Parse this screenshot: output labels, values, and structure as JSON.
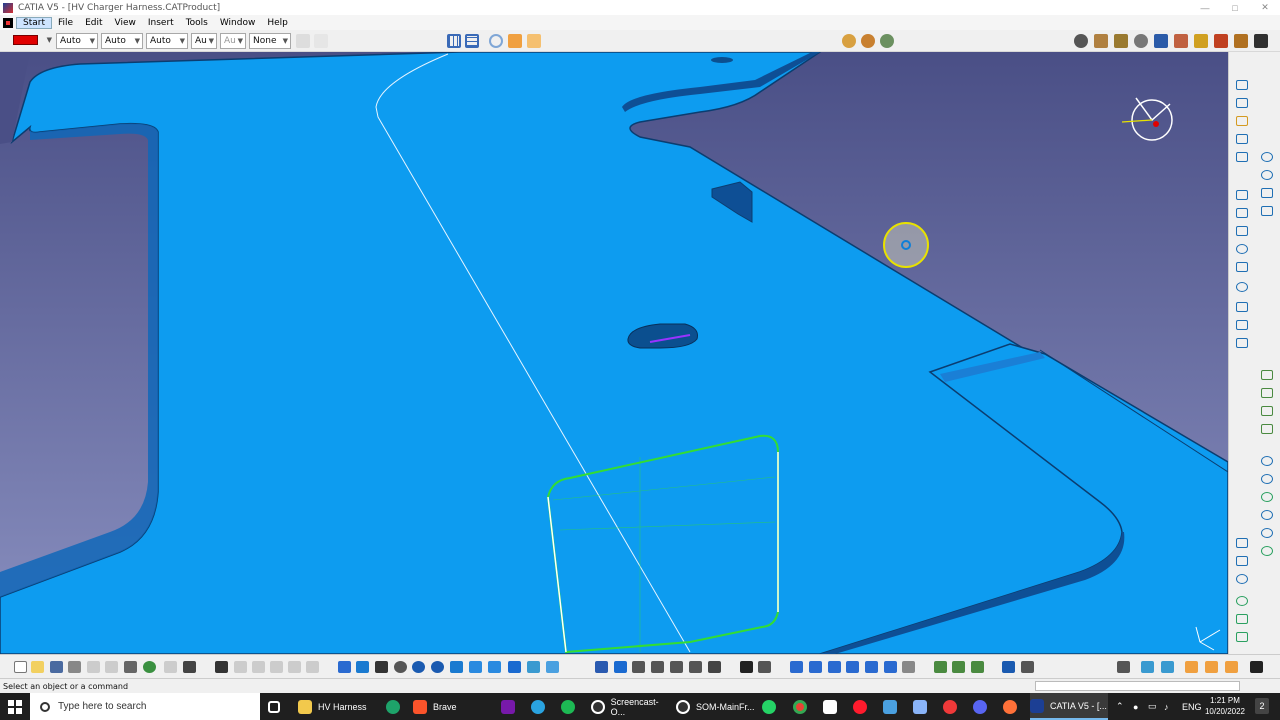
{
  "window": {
    "title": "CATIA V5 - [HV Charger Harness.CATProduct]",
    "controls": [
      "minimize-icon",
      "maximize-icon",
      "close-icon"
    ]
  },
  "menubar": {
    "items": [
      "Start",
      "File",
      "Edit",
      "View",
      "Insert",
      "Tools",
      "Window",
      "Help"
    ]
  },
  "toolbar": {
    "color_swatch": "#e00000",
    "combos": [
      {
        "value": "Auto"
      },
      {
        "value": "Auto"
      },
      {
        "value": "Auto"
      },
      {
        "value": "Au"
      },
      {
        "value": "Au"
      },
      {
        "value": "None"
      }
    ]
  },
  "viewport": {
    "background": "#0d9cf0",
    "surface_color": "#0d9cf0",
    "edge_color": "#0b4f8f",
    "highlight_color": "#33dd33",
    "cursor_indicator_color": "#e8e200"
  },
  "status": {
    "text": "Select an object or a command"
  },
  "taskbar": {
    "search_placeholder": "Type here to search",
    "tasks": [
      {
        "label": "HV Harness",
        "icon": "folder-icon"
      },
      {
        "label": "Brave",
        "icon": "brave-icon"
      },
      {
        "label": "Screencast-O...",
        "icon": "screencast-icon"
      },
      {
        "label": "SOM-MainFr...",
        "icon": "app-icon"
      },
      {
        "label": "CATIA V5 - [...",
        "icon": "catia-icon"
      }
    ],
    "tray": {
      "language": "ENG",
      "time": "1:21 PM",
      "date": "10/20/2022",
      "notification_count": "2"
    }
  }
}
